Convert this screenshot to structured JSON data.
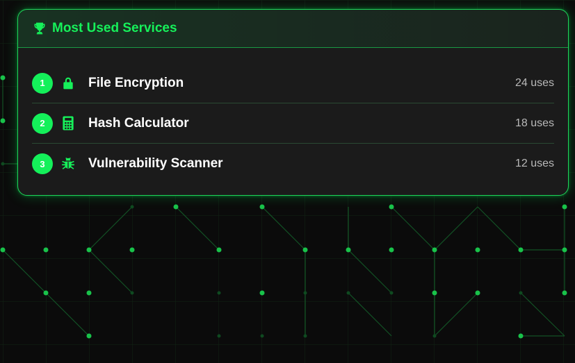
{
  "colors": {
    "accent": "#16f05a",
    "card_bg": "#1b1b1b",
    "page_bg": "#0b0b0b"
  },
  "card": {
    "title": "Most Used Services",
    "icon": "trophy-icon"
  },
  "services": [
    {
      "rank": "1",
      "icon": "lock-icon",
      "name": "File Encryption",
      "uses": "24 uses"
    },
    {
      "rank": "2",
      "icon": "calculator-icon",
      "name": "Hash Calculator",
      "uses": "18 uses"
    },
    {
      "rank": "3",
      "icon": "bug-icon",
      "name": "Vulnerability Scanner",
      "uses": "12 uses"
    }
  ]
}
